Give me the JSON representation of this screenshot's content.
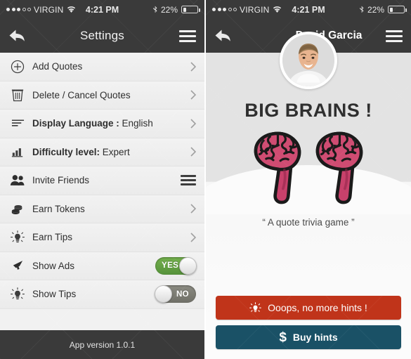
{
  "status_bar": {
    "signal_dots_filled": 3,
    "signal_dots_total": 5,
    "carrier": "VIRGIN",
    "time": "4:21 PM",
    "battery_percent": "22%",
    "battery_level": 22,
    "wifi_icon": "wifi-icon",
    "bluetooth_icon": "bluetooth-icon"
  },
  "settings_screen": {
    "nav": {
      "back_icon": "back-arrow-icon",
      "title": "Settings",
      "menu_icon": "hamburger-menu-icon"
    },
    "rows": [
      {
        "icon": "plus-circle-icon",
        "label": "Add Quotes",
        "accessory": "chevron",
        "bold": false
      },
      {
        "icon": "trash-icon",
        "label": "Delete / Cancel Quotes",
        "accessory": "chevron",
        "bold": false
      },
      {
        "icon": "text-lines-icon",
        "label": "Display Language : English",
        "accessory": "chevron",
        "bold": true,
        "bold_part": "Display Language :",
        "regular_part": " English"
      },
      {
        "icon": "bar-chart-icon",
        "label": "Difficulty level: Expert",
        "accessory": "chevron",
        "bold": true,
        "bold_part": "Difficulty level:",
        "regular_part": " Expert"
      },
      {
        "icon": "people-icon",
        "label": "Invite Friends",
        "accessory": "hamburger",
        "bold": false
      },
      {
        "icon": "coins-icon",
        "label": "Earn Tokens",
        "accessory": "chevron",
        "bold": false
      },
      {
        "icon": "lightbulb-icon",
        "label": "Earn Tips",
        "accessory": "chevron",
        "bold": false
      },
      {
        "icon": "megaphone-icon",
        "label": "Show Ads",
        "accessory": "toggle",
        "toggle_state": "on",
        "toggle_label": "YES",
        "bold": false
      },
      {
        "icon": "lightbulb-icon",
        "label": "Show Tips",
        "accessory": "toggle",
        "toggle_state": "off",
        "toggle_label": "NO",
        "bold": false
      }
    ],
    "footer": "App version 1.0.1"
  },
  "profile_screen": {
    "nav": {
      "back_icon": "back-arrow-icon",
      "user_name": "David Garcia",
      "menu_icon": "hamburger-menu-icon",
      "avatar": "user-avatar"
    },
    "title": "BIG BRAINS !",
    "logo": "brain-quotation-marks-logo",
    "tagline": "“ A quote trivia game ”",
    "buttons": {
      "hints": {
        "icon": "lightbulb-icon",
        "label": "Ooops, no more hints !"
      },
      "buy": {
        "icon": "dollar-icon",
        "label": "Buy hints"
      }
    }
  },
  "colors": {
    "nav_dark": "#3a3a3a",
    "list_bg": "#efefef",
    "toggle_on": "#5a9a3c",
    "toggle_off": "#7c7c74",
    "button_red": "#c0341a",
    "button_blue": "#1a5166",
    "brain_pink": "#c8416b"
  }
}
